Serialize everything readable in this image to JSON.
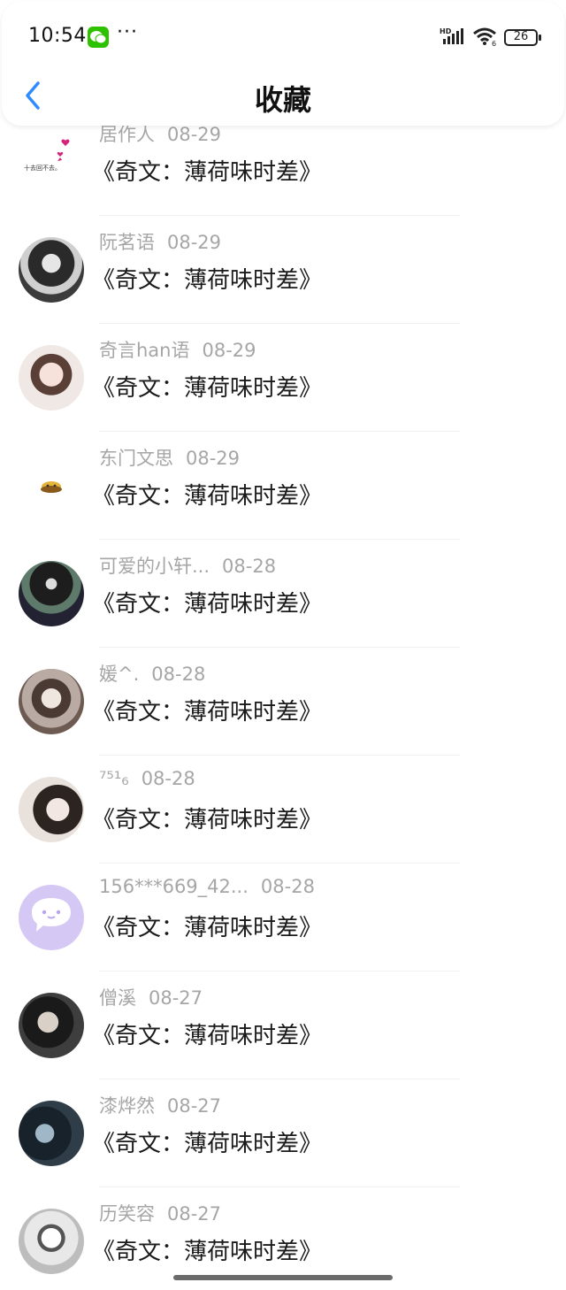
{
  "status_bar": {
    "time": "10:54",
    "icons": [
      "wechat-icon",
      "more-icon",
      "hd-signal-icon",
      "wifi-icon",
      "battery-icon"
    ],
    "more": "···",
    "battery": "26"
  },
  "header": {
    "back_icon": "chevron-left-icon",
    "title": "收藏"
  },
  "items": [
    {
      "user": "居作人",
      "date": "08-29",
      "title": "《奇文：薄荷味时差》",
      "avatar": "avatar-hearts"
    },
    {
      "user": "阮茗语",
      "date": "08-29",
      "title": "《奇文：薄荷味时差》",
      "avatar": "avatar-photo"
    },
    {
      "user": "奇言han语",
      "date": "08-29",
      "title": "《奇文：薄荷味时差》",
      "avatar": "avatar-photo"
    },
    {
      "user": "东门文思",
      "date": "08-29",
      "title": "《奇文：薄荷味时差》",
      "avatar": "avatar-sticker"
    },
    {
      "user": "可爱的小轩...",
      "date": "08-28",
      "title": "《奇文：薄荷味时差》",
      "avatar": "avatar-photo"
    },
    {
      "user": "媛^.",
      "date": "08-28",
      "title": "《奇文：薄荷味时差》",
      "avatar": "avatar-photo"
    },
    {
      "user": "⁷⁵¹₆",
      "date": "08-28",
      "title": "《奇文：薄荷味时差》",
      "avatar": "avatar-photo"
    },
    {
      "user": "156***669_42...",
      "date": "08-28",
      "title": "《奇文：薄荷味时差》",
      "avatar": "avatar-default"
    },
    {
      "user": "僧溪",
      "date": "08-27",
      "title": "《奇文：薄荷味时差》",
      "avatar": "avatar-photo"
    },
    {
      "user": "漆烨然",
      "date": "08-27",
      "title": "《奇文：薄荷味时差》",
      "avatar": "avatar-photo"
    },
    {
      "user": "历笑容",
      "date": "08-27",
      "title": "《奇文：薄荷味时差》",
      "avatar": "avatar-photo"
    }
  ],
  "colors": {
    "accent_blue": "#2f8cff",
    "meta_gray": "#a6a6a6",
    "default_avatar": "#d6c8f5"
  }
}
